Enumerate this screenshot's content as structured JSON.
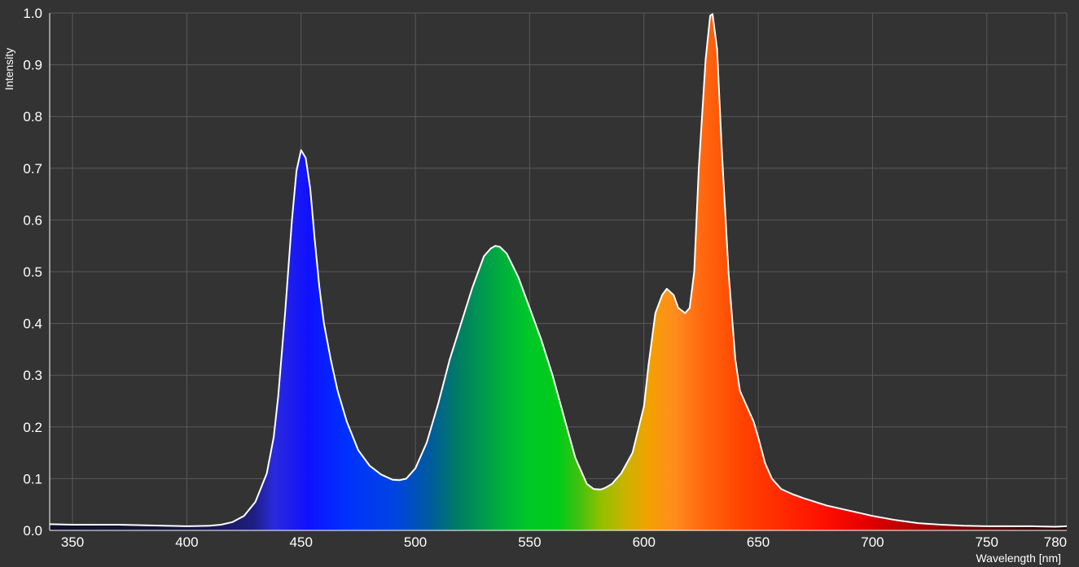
{
  "chart_data": {
    "type": "area",
    "title": "",
    "xlabel": "Wavelength [nm]",
    "ylabel": "Intensity",
    "xlim": [
      340,
      785
    ],
    "ylim": [
      0,
      1.0
    ],
    "x_ticks": [
      "350",
      "400",
      "450",
      "500",
      "550",
      "600",
      "650",
      "700",
      "750",
      "780"
    ],
    "y_ticks": [
      "0.0",
      "0.1",
      "0.2",
      "0.3",
      "0.4",
      "0.5",
      "0.6",
      "0.7",
      "0.8",
      "0.9",
      "1.0"
    ],
    "grid": true,
    "colors": {
      "background": "#333333",
      "grid": "#5a5a5a",
      "line": "#ffffff",
      "text": "#ffffff"
    },
    "series": [
      {
        "x": [
          340,
          350,
          360,
          370,
          380,
          390,
          400,
          410,
          415,
          420,
          425,
          430,
          435,
          438,
          440,
          443,
          446,
          448,
          450,
          452,
          454,
          456,
          458,
          460,
          463,
          466,
          470,
          475,
          480,
          485,
          490,
          493,
          496,
          500,
          505,
          510,
          515,
          520,
          525,
          530,
          533,
          535,
          537,
          540,
          545,
          550,
          555,
          560,
          565,
          570,
          575,
          578,
          581,
          583,
          586,
          590,
          595,
          600,
          602,
          605,
          608,
          610,
          613,
          615,
          618,
          620,
          622,
          624,
          627,
          629,
          630,
          632,
          634,
          637,
          640,
          642,
          645,
          648,
          650,
          653,
          656,
          660,
          665,
          670,
          680,
          690,
          700,
          710,
          720,
          730,
          740,
          750,
          760,
          770,
          780,
          785
        ],
        "y": [
          0.012,
          0.011,
          0.011,
          0.011,
          0.01,
          0.009,
          0.008,
          0.009,
          0.011,
          0.016,
          0.028,
          0.055,
          0.11,
          0.18,
          0.26,
          0.42,
          0.6,
          0.695,
          0.735,
          0.72,
          0.66,
          0.56,
          0.47,
          0.4,
          0.33,
          0.27,
          0.21,
          0.155,
          0.125,
          0.108,
          0.098,
          0.097,
          0.1,
          0.12,
          0.17,
          0.245,
          0.33,
          0.4,
          0.47,
          0.53,
          0.545,
          0.55,
          0.548,
          0.535,
          0.49,
          0.43,
          0.37,
          0.3,
          0.22,
          0.14,
          0.09,
          0.08,
          0.079,
          0.082,
          0.09,
          0.11,
          0.15,
          0.24,
          0.32,
          0.42,
          0.455,
          0.467,
          0.455,
          0.43,
          0.42,
          0.43,
          0.5,
          0.7,
          0.91,
          0.995,
          0.998,
          0.93,
          0.74,
          0.5,
          0.33,
          0.27,
          0.24,
          0.21,
          0.18,
          0.13,
          0.1,
          0.08,
          0.07,
          0.062,
          0.048,
          0.038,
          0.028,
          0.02,
          0.014,
          0.011,
          0.009,
          0.008,
          0.008,
          0.008,
          0.007,
          0.008
        ]
      }
    ]
  }
}
